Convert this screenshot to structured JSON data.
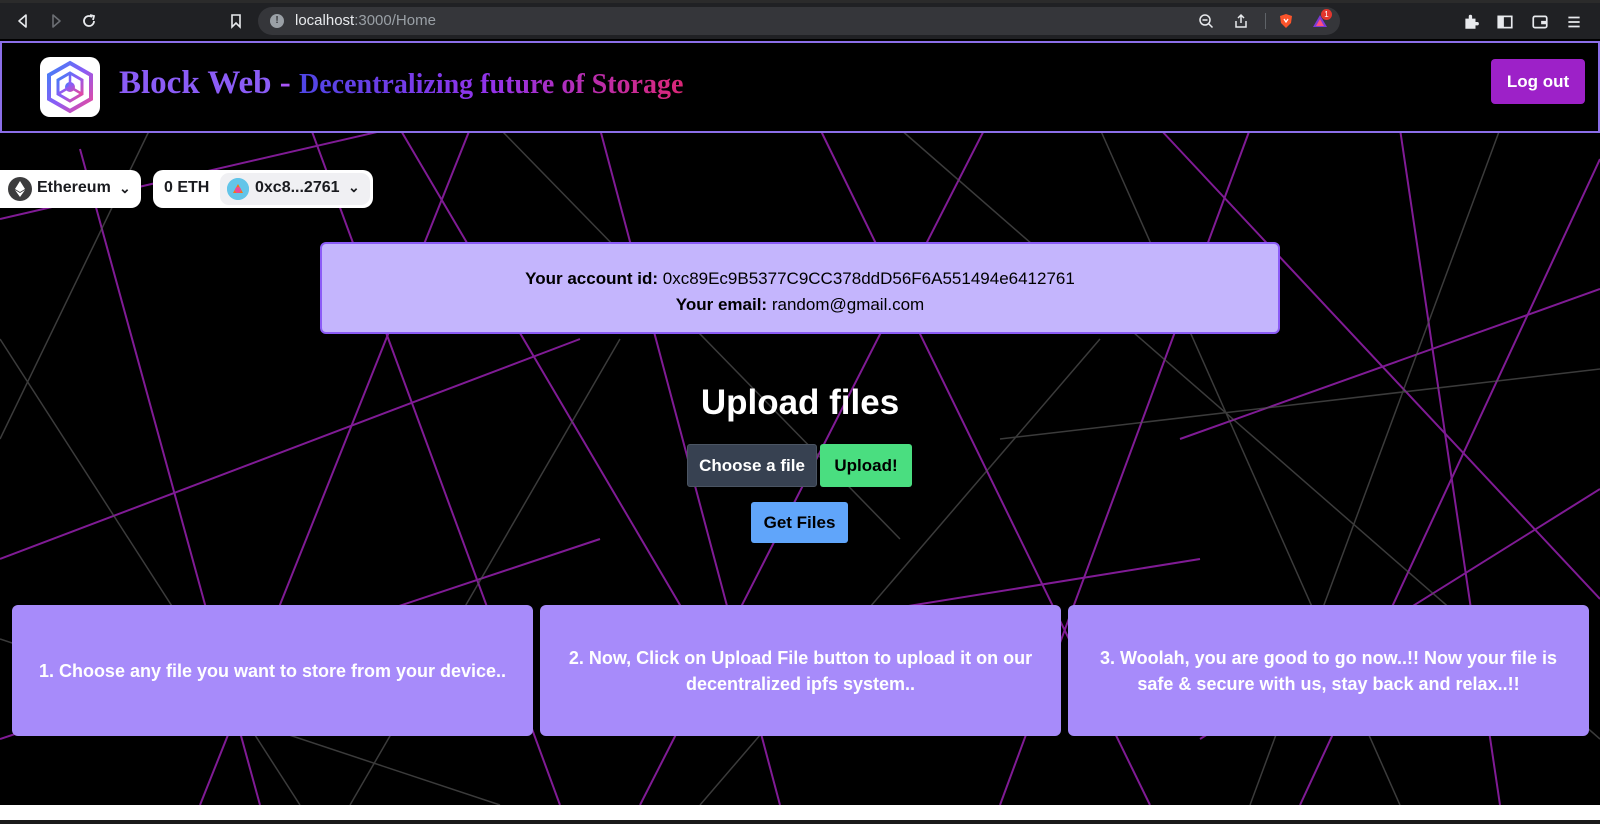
{
  "browser": {
    "url_host": "localhost",
    "url_path": ":3000/Home",
    "extension_badge": "1"
  },
  "header": {
    "brand": "Block Web",
    "dash": " - ",
    "tagline": "Decentralizing future of Storage",
    "logout_label": "Log out"
  },
  "wallet": {
    "chain": "Ethereum",
    "balance": "0 ETH",
    "address_short": "0xc8...2761"
  },
  "account": {
    "id_label": "Your account id:",
    "id_value": "0xc89Ec9B5377C9CC378ddD56F6A551494e6412761",
    "email_label": "Your email:",
    "email_value": "random@gmail.com"
  },
  "upload": {
    "title": "Upload files",
    "choose_label": "Choose a file",
    "upload_label": "Upload!",
    "get_files_label": "Get Files"
  },
  "steps": [
    {
      "text": "1. Choose any file you want to store from your device.."
    },
    {
      "text": "2. Now, Click on Upload File button to upload it on our decentralized ipfs system.."
    },
    {
      "text": "3. Woolah, you are good to go now..!! Now your file is safe & secure with us, stay back and relax..!!"
    }
  ],
  "colors": {
    "accent_purple": "#8b5cf6",
    "logout_bg": "#9d21c8",
    "upload_green": "#4ade80",
    "getfiles_blue": "#60a5fa",
    "card_purple": "#a78bfa",
    "info_lavender": "#c4b5fd"
  }
}
